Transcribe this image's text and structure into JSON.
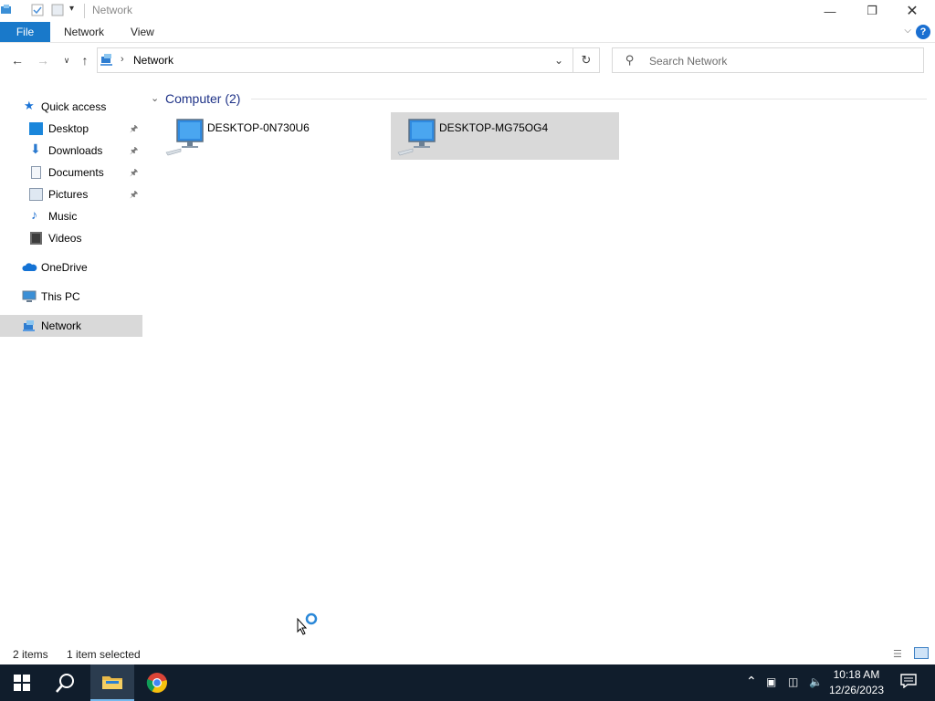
{
  "window": {
    "title": "Network"
  },
  "ribbon": {
    "tabs": [
      "File",
      "Network",
      "View"
    ],
    "help_label": "?"
  },
  "address": {
    "location": "Network",
    "separator": "›",
    "search_placeholder": "Search Network"
  },
  "navpane": {
    "quick_access": "Quick access",
    "items": [
      {
        "label": "Desktop",
        "icon": "desktop-icon",
        "pinned": true
      },
      {
        "label": "Downloads",
        "icon": "downloads-icon",
        "pinned": true
      },
      {
        "label": "Documents",
        "icon": "documents-icon",
        "pinned": true
      },
      {
        "label": "Pictures",
        "icon": "pictures-icon",
        "pinned": true
      },
      {
        "label": "Music",
        "icon": "music-icon",
        "pinned": false
      },
      {
        "label": "Videos",
        "icon": "videos-icon",
        "pinned": false
      }
    ],
    "onedrive": "OneDrive",
    "this_pc": "This PC",
    "network": "Network"
  },
  "content": {
    "group_label": "Computer (2)",
    "computers": [
      {
        "name": "DESKTOP-0N730U6",
        "selected": false
      },
      {
        "name": "DESKTOP-MG75OG4",
        "selected": true
      }
    ]
  },
  "status": {
    "item_count": "2 items",
    "selection": "1 item selected"
  },
  "taskbar": {
    "time": "10:18 AM",
    "date": "12/26/2023"
  },
  "colors": {
    "accent": "#1979ca",
    "selection": "#d9d9d9",
    "taskbar": "#101d2c",
    "group_header": "#1e3287"
  }
}
